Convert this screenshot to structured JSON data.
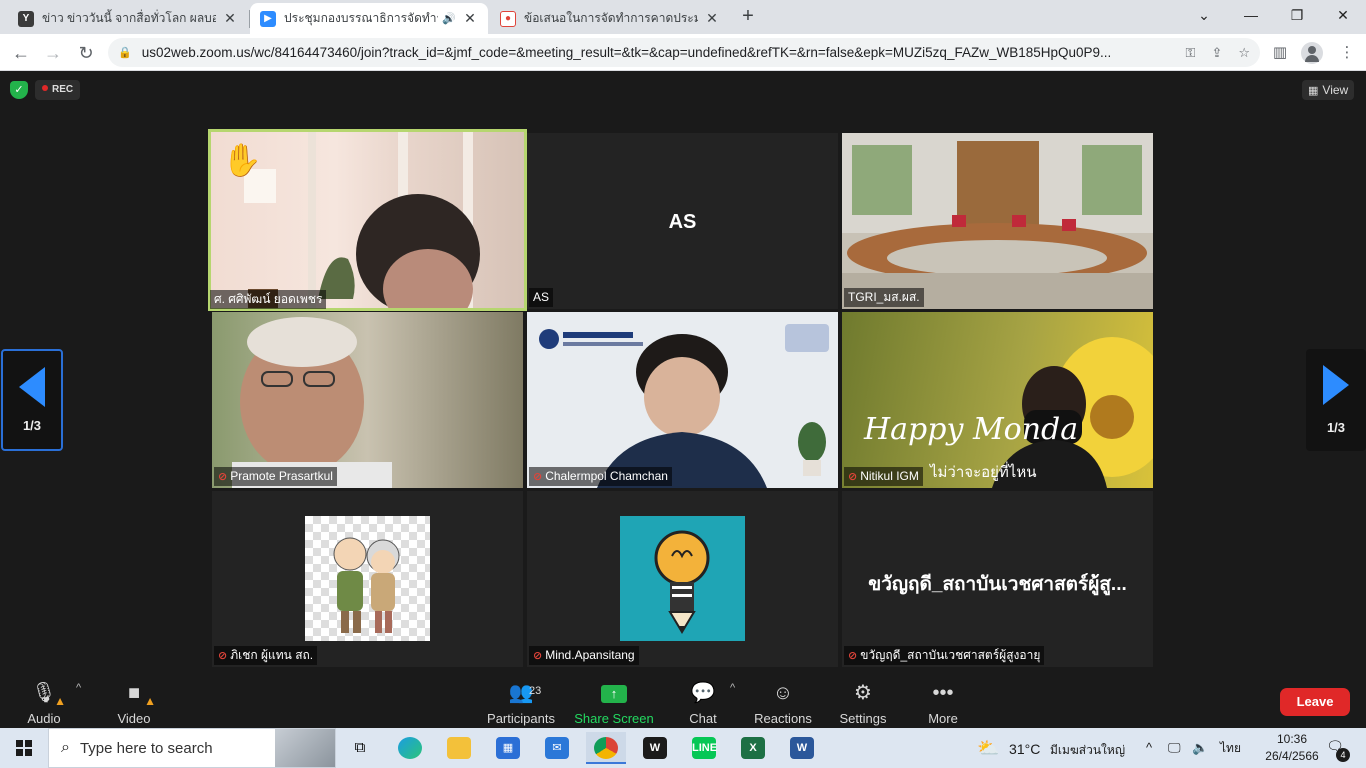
{
  "browser": {
    "tabs": [
      {
        "title": "ข่าว ข่าววันนี้ จากสื่อทั่วโลก ผลบอลโลก",
        "favicon": "news-favicon",
        "color": "#3b3b3b"
      },
      {
        "title": "ประชุมกองบรรณาธิการจัดทำราย",
        "favicon": "zoom-favicon",
        "color": "#2d8cff"
      },
      {
        "title": "ข้อเสนอในการจัดทำการคาดประมาณป",
        "favicon": "slides-favicon",
        "color": "#e0443a"
      }
    ],
    "url": "us02web.zoom.us/wc/84164473460/join?track_id=&jmf_code=&meeting_result=&tk=&cap=undefined&refTK=&rn=false&epk=MUZi5zq_FAZw_WB185HpQu0P9..."
  },
  "zoom": {
    "rec_label": "REC",
    "view_label": "View",
    "page_left": "1/3",
    "page_right": "1/3",
    "participants": [
      {
        "name": "ศ. ศศิพัฒน์ ยอดเพชร",
        "muted": false,
        "initials": "",
        "active": true
      },
      {
        "name": "AS",
        "muted": false,
        "initials": "AS",
        "active": false
      },
      {
        "name": "TGRI_มส.ผส.",
        "muted": false,
        "initials": "",
        "active": false
      },
      {
        "name": "Pramote Prasartkul",
        "muted": true,
        "initials": "",
        "active": false
      },
      {
        "name": "Chalermpol Chamchan",
        "muted": true,
        "initials": "",
        "active": false
      },
      {
        "name": "Nitikul IGM",
        "muted": true,
        "initials": "",
        "active": false
      },
      {
        "name": "ภิเชก ผู้แทน สถ.",
        "muted": true,
        "initials": "",
        "active": false
      },
      {
        "name": "Mind.Apansitang",
        "muted": true,
        "initials": "",
        "active": false
      },
      {
        "name": "ขวัญฤดี_สถาบันเวชศาสตร์ผู้สูงอายุ",
        "muted": true,
        "initials": "ขวัญฤดี_สถาบันเวชศาสตร์ผู้สู...",
        "active": false
      }
    ],
    "video_overlay_text": {
      "happy": "Happy Monda",
      "sub": "ไม่ว่าจะอยู่ที่ไหน"
    },
    "toolbar": {
      "audio": "Audio",
      "video": "Video",
      "participants": "Participants",
      "participants_count": "23",
      "share_screen": "Share Screen",
      "chat": "Chat",
      "reactions": "Reactions",
      "settings": "Settings",
      "more": "More",
      "leave": "Leave"
    }
  },
  "taskbar": {
    "search_placeholder": "Type here to search",
    "weather_temp": "31°C",
    "weather_text": "มีเมฆส่วนใหญ่",
    "language": "ไทย",
    "time": "10:36",
    "date": "26/4/2566",
    "notifications": "4"
  }
}
